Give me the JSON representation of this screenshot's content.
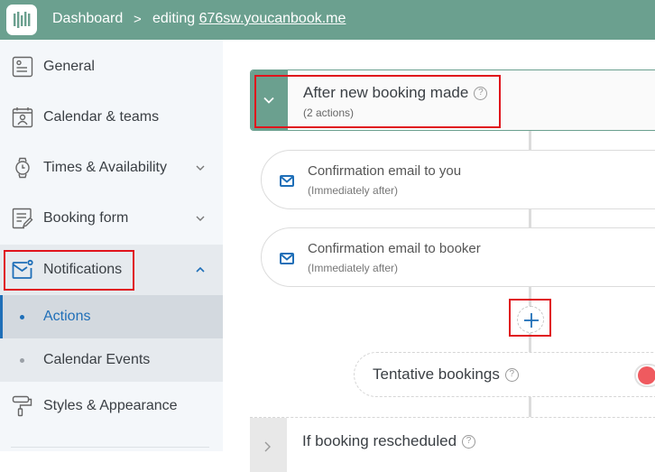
{
  "header": {
    "logo_icon": "youcanbook-logo-icon",
    "breadcrumb_dashboard": "Dashboard",
    "breadcrumb_separator": ">",
    "breadcrumb_editing_prefix": "editing",
    "breadcrumb_site": "676sw.youcanbook.me"
  },
  "sidebar": {
    "items": [
      {
        "label": "General",
        "icon": "id-card-icon"
      },
      {
        "label": "Calendar & teams",
        "icon": "calendar-person-icon"
      },
      {
        "label": "Times & Availability",
        "icon": "watch-icon",
        "expandable": true
      },
      {
        "label": "Booking form",
        "icon": "form-edit-icon",
        "expandable": true
      },
      {
        "label": "Notifications",
        "icon": "mail-notification-icon",
        "expanded": true,
        "subitems": [
          {
            "label": "Actions",
            "active": true
          },
          {
            "label": "Calendar Events",
            "active": false
          }
        ]
      },
      {
        "label": "Styles & Appearance",
        "icon": "paint-roller-icon"
      }
    ]
  },
  "main": {
    "trigger_new_booking": {
      "title": "After new booking made",
      "subtitle": "(2 actions)",
      "help_glyph": "?"
    },
    "actions": [
      {
        "title": "Confirmation email to you",
        "timing": "(Immediately after)",
        "icon": "email-icon"
      },
      {
        "title": "Confirmation email to booker",
        "timing": "(Immediately after)",
        "icon": "email-icon"
      }
    ],
    "add_action_icon": "plus-icon",
    "tentative": {
      "label": "Tentative bookings",
      "help_glyph": "?",
      "toggle_state": "off"
    },
    "trigger_rescheduled": {
      "title": "If booking rescheduled",
      "help_glyph": "?"
    }
  },
  "colors": {
    "brand_green": "#6ba08f",
    "accent_blue": "#1f6fb8",
    "highlight_red": "#e0141c",
    "toggle_red": "#ef5a5f"
  }
}
